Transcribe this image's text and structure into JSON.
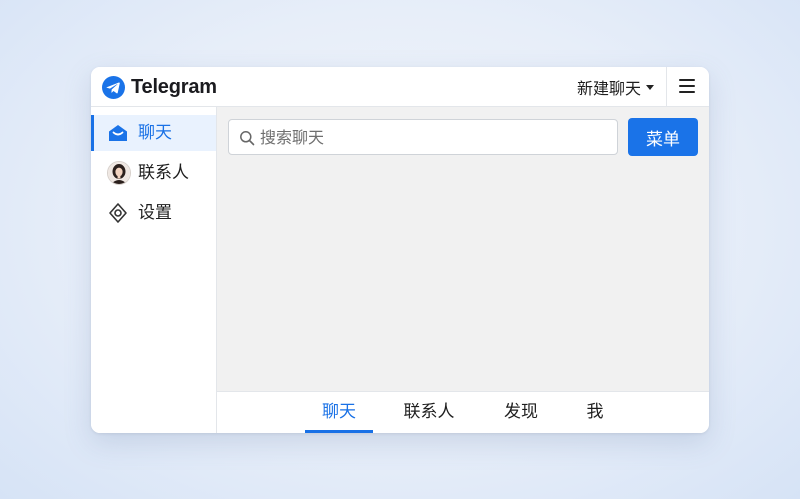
{
  "app": {
    "brand": "Telegram",
    "accent_color": "#1a73e8",
    "logo_icon": "telegram-logo-icon"
  },
  "header": {
    "new_chat_label": "新建聊天",
    "new_chat_icon": "caret-down-icon",
    "menu_icon": "hamburger-menu-icon"
  },
  "sidebar": {
    "items": [
      {
        "label": "聊天",
        "icon": "chat-inbox-icon",
        "active": true
      },
      {
        "label": "联系人",
        "icon": "contact-avatar",
        "active": false
      },
      {
        "label": "设置",
        "icon": "settings-icon",
        "active": false
      }
    ]
  },
  "search": {
    "placeholder": "搜索聊天",
    "value": "",
    "icon": "search-icon"
  },
  "toolbar": {
    "menu_label": "菜单"
  },
  "tabs": [
    {
      "label": "聊天",
      "active": true
    },
    {
      "label": "联系人",
      "active": false
    },
    {
      "label": "发现",
      "active": false
    },
    {
      "label": "我",
      "active": false
    }
  ]
}
